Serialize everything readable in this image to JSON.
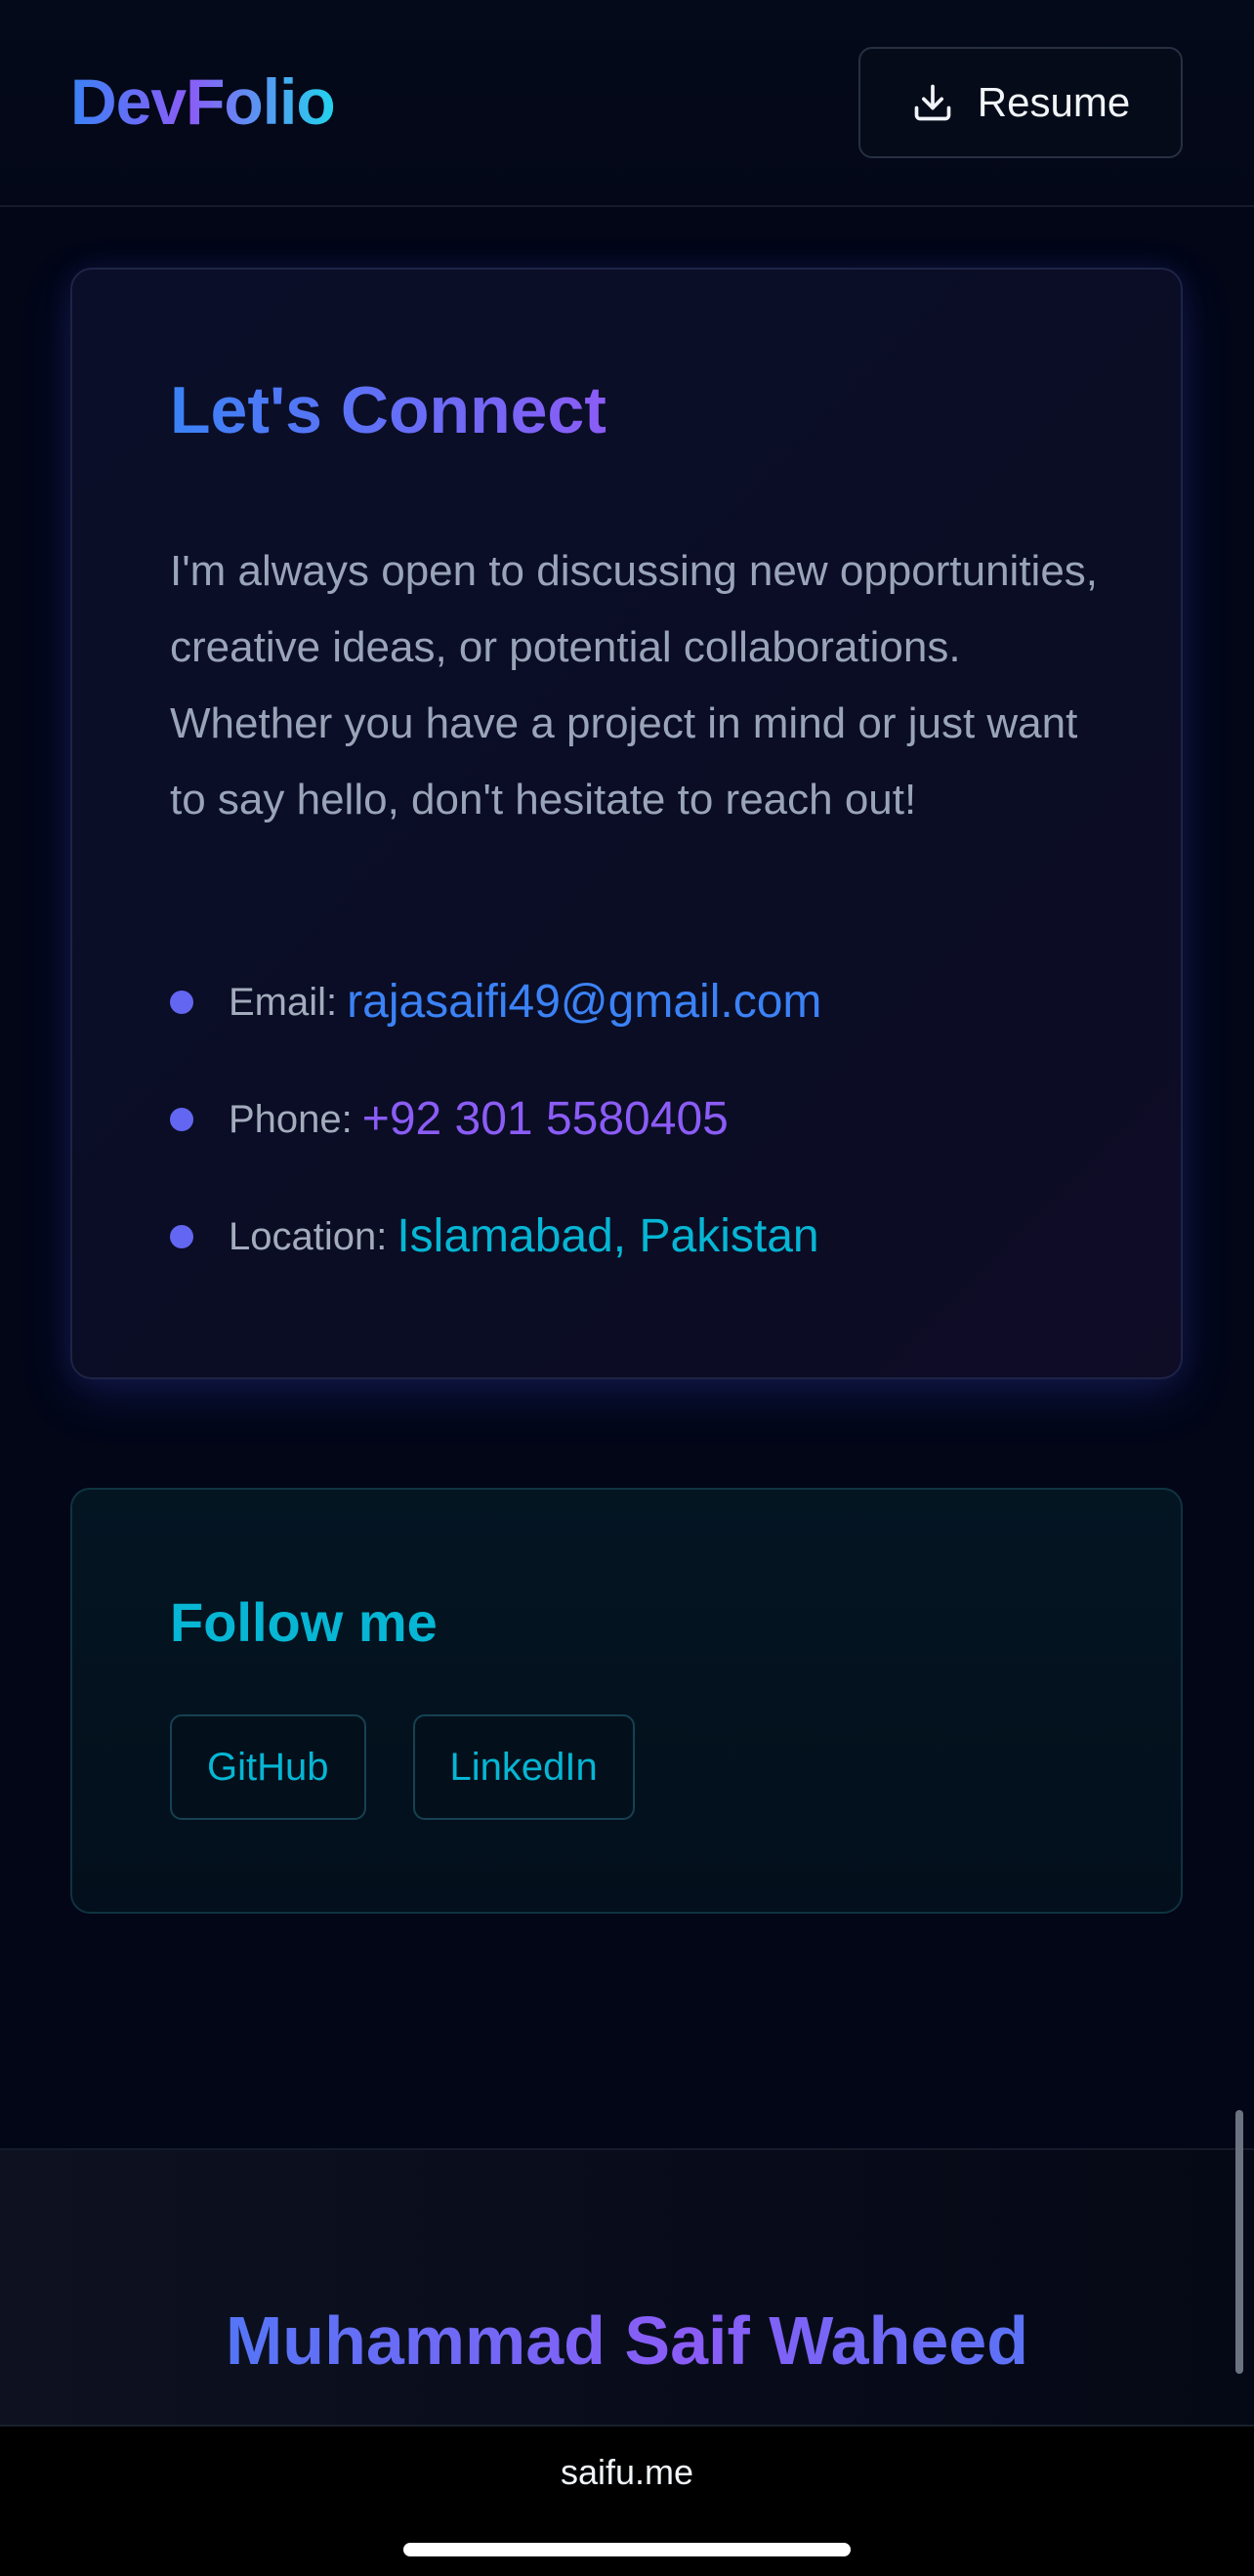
{
  "header": {
    "logo": "DevFolio",
    "resume_label": "Resume"
  },
  "connect": {
    "title": "Let's Connect",
    "description": "I'm always open to discussing new opportunities, creative ideas, or potential collaborations. Whether you have a project in mind or just want to say hello, don't hesitate to reach out!",
    "items": [
      {
        "label": "Email:",
        "value": "rajasaifi49@gmail.com"
      },
      {
        "label": "Phone:",
        "value": "+92 301 5580405"
      },
      {
        "label": "Location:",
        "value": "Islamabad, Pakistan"
      }
    ]
  },
  "follow": {
    "title": "Follow me",
    "links": [
      "GitHub",
      "LinkedIn"
    ]
  },
  "footer": {
    "name": "Muhammad Saif Waheed"
  },
  "browser": {
    "url": "saifu.me"
  },
  "colors": {
    "background": "#020617",
    "accent_blue": "#3b82f6",
    "accent_purple": "#8b5cf6",
    "accent_cyan": "#06b6d4"
  },
  "icons": {
    "resume": "download-icon"
  }
}
